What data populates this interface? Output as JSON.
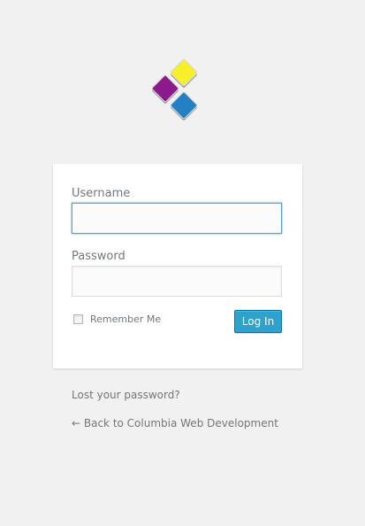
{
  "logo": {
    "icon": "colored-squares-logo-icon",
    "colors": {
      "yellow": "#f7ef2b",
      "purple": "#8c1a8c",
      "blue": "#2380c2"
    }
  },
  "form": {
    "username_label": "Username",
    "username_value": "",
    "password_label": "Password",
    "password_value": "",
    "remember_label": "Remember Me",
    "login_button": "Log In",
    "accent_color": "#2ea2cc"
  },
  "links": {
    "lost_password": "Lost your password?",
    "back_to_site": "← Back to Columbia Web Development"
  }
}
